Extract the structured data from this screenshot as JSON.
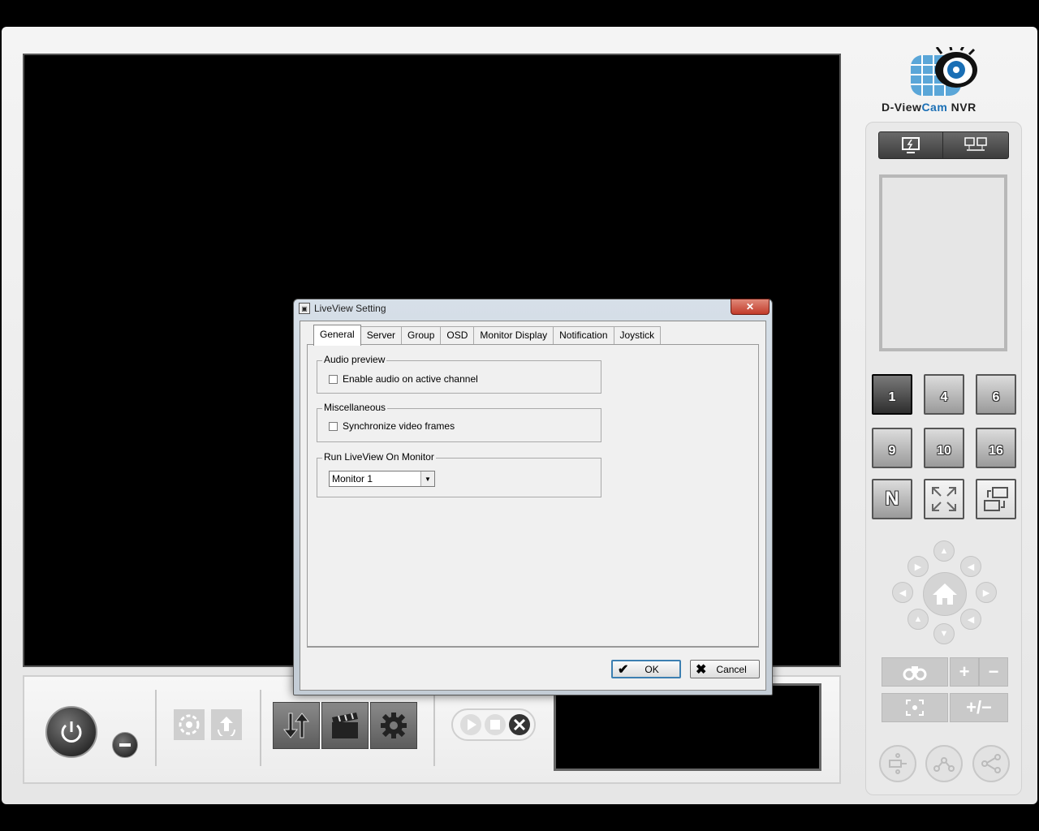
{
  "app": {
    "brand_prefix": "D-View",
    "brand_cam": "Cam",
    "brand_suffix": " NVR"
  },
  "layout_buttons": [
    "1",
    "4",
    "6",
    "9",
    "10",
    "16",
    "N"
  ],
  "icons": {
    "local_monitor": "monitor-lightning-icon",
    "remote_monitor": "network-monitors-icon",
    "fullscreen": "expand-arrows-icon",
    "swap": "swap-screens-icon",
    "power": "power-icon",
    "minimize": "minus-icon",
    "ptz_home": "home-icon",
    "zoom_in": "plus-icon",
    "zoom_out": "minus-icon",
    "focus": "focus-icon",
    "auto_focus": "plus-minus-icon",
    "binoculars": "binoculars-icon",
    "playback": "play-icon",
    "stop": "stop-icon",
    "close": "close-icon",
    "backup": "backup-arrows-icon",
    "clapper": "clapperboard-icon",
    "settings": "gear-icon"
  },
  "dialog": {
    "title": "LiveView Setting",
    "close_label": "✕",
    "tabs": [
      "General",
      "Server",
      "Group",
      "OSD",
      "Monitor Display",
      "Notification",
      "Joystick"
    ],
    "audio_group_label": "Audio preview",
    "audio_checkbox_label": "Enable audio on active channel",
    "misc_group_label": "Miscellaneous",
    "sync_checkbox_label": "Synchronize video frames",
    "monitor_group_label": "Run LiveView On Monitor",
    "monitor_select_value": "Monitor 1",
    "ok_label": "OK",
    "cancel_label": "Cancel"
  },
  "colors": {
    "accent_blue": "#1a6fb5",
    "close_red": "#c23b2a"
  }
}
